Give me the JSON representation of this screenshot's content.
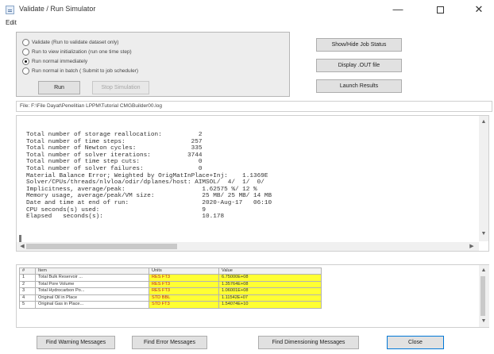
{
  "window": {
    "title": "Validate / Run Simulator",
    "minimize_glyph": "—",
    "close_glyph": "✕"
  },
  "menu": {
    "edit": "Edit"
  },
  "run_options": [
    {
      "label": "Validate (Run to validate dataset only)",
      "checked": false
    },
    {
      "label": "Run to view initialization (run one time step)",
      "checked": false
    },
    {
      "label": "Run normal immediately",
      "checked": true
    },
    {
      "label": "Run normal in batch ( Submit to job scheduler)",
      "checked": false
    }
  ],
  "buttons": {
    "run": "Run",
    "stop_simulation": "Stop Simulation",
    "show_hide_job_status": "Show/Hide Job Status",
    "display_out_file": "Display .OUT file",
    "launch_results": "Launch Results",
    "find_warning": "Find Warning Messages",
    "find_error": "Find Error Messages",
    "find_dimensioning": "Find Dimensioning Messages",
    "close": "Close"
  },
  "file_path": "File: F:\\File Dayat\\Penelitian LPPM\\Tutorial CMGBuilder00.log",
  "log_lines": [
    "Total number of storage reallocation:          2",
    "Total number of time steps:                  257",
    "Total number of Newton cycles:               335",
    "Total number of solver iterations:          3744",
    "Total number of time step cuts:                0",
    "Total number of solver failures:               0",
    "Material Balance Error; Weighted by OrigMatInPlace+Inj:    1.1369E",
    "Solver/CPUs/threads/nlvloa/odir/dplanes/host: AIMSOL/  4/  1/  0/",
    "Implicitness, average/peak:                     1.62575 %/ 12 %",
    "Memory usage, average/peak/VM size:             25 MB/ 25 MB/ 14 MB",
    "Date and time at end of run:                    2020-Aug-17   06:10",
    "CPU seconds(s) used:                            9",
    "Elapsed   seconds(s):                           10.178"
  ],
  "table": {
    "headers": [
      "#",
      "Item",
      "Units",
      "Value"
    ],
    "rows": [
      [
        "1",
        "Total Bulk Reservoir ...",
        "RES FT3",
        "6.75000E+08"
      ],
      [
        "2",
        "Total Pore Volume",
        "RES FT3",
        "1.35764E+08"
      ],
      [
        "3",
        "Total Hydrocarbon Po...",
        "RES FT3",
        "1.06001E+08"
      ],
      [
        "4",
        "Original Oil in Place",
        "STD BBL",
        "1.11542E+07"
      ],
      [
        "5",
        "Original Gas in Place...",
        "STD FT3",
        "1.54074E+10"
      ]
    ]
  },
  "icons": {
    "app": "app-window-icon",
    "minimize": "minimize-icon",
    "maximize": "maximize-icon",
    "close": "close-icon"
  },
  "colors": {
    "value_highlight": "#ffff33",
    "units_text": "#c02020"
  }
}
